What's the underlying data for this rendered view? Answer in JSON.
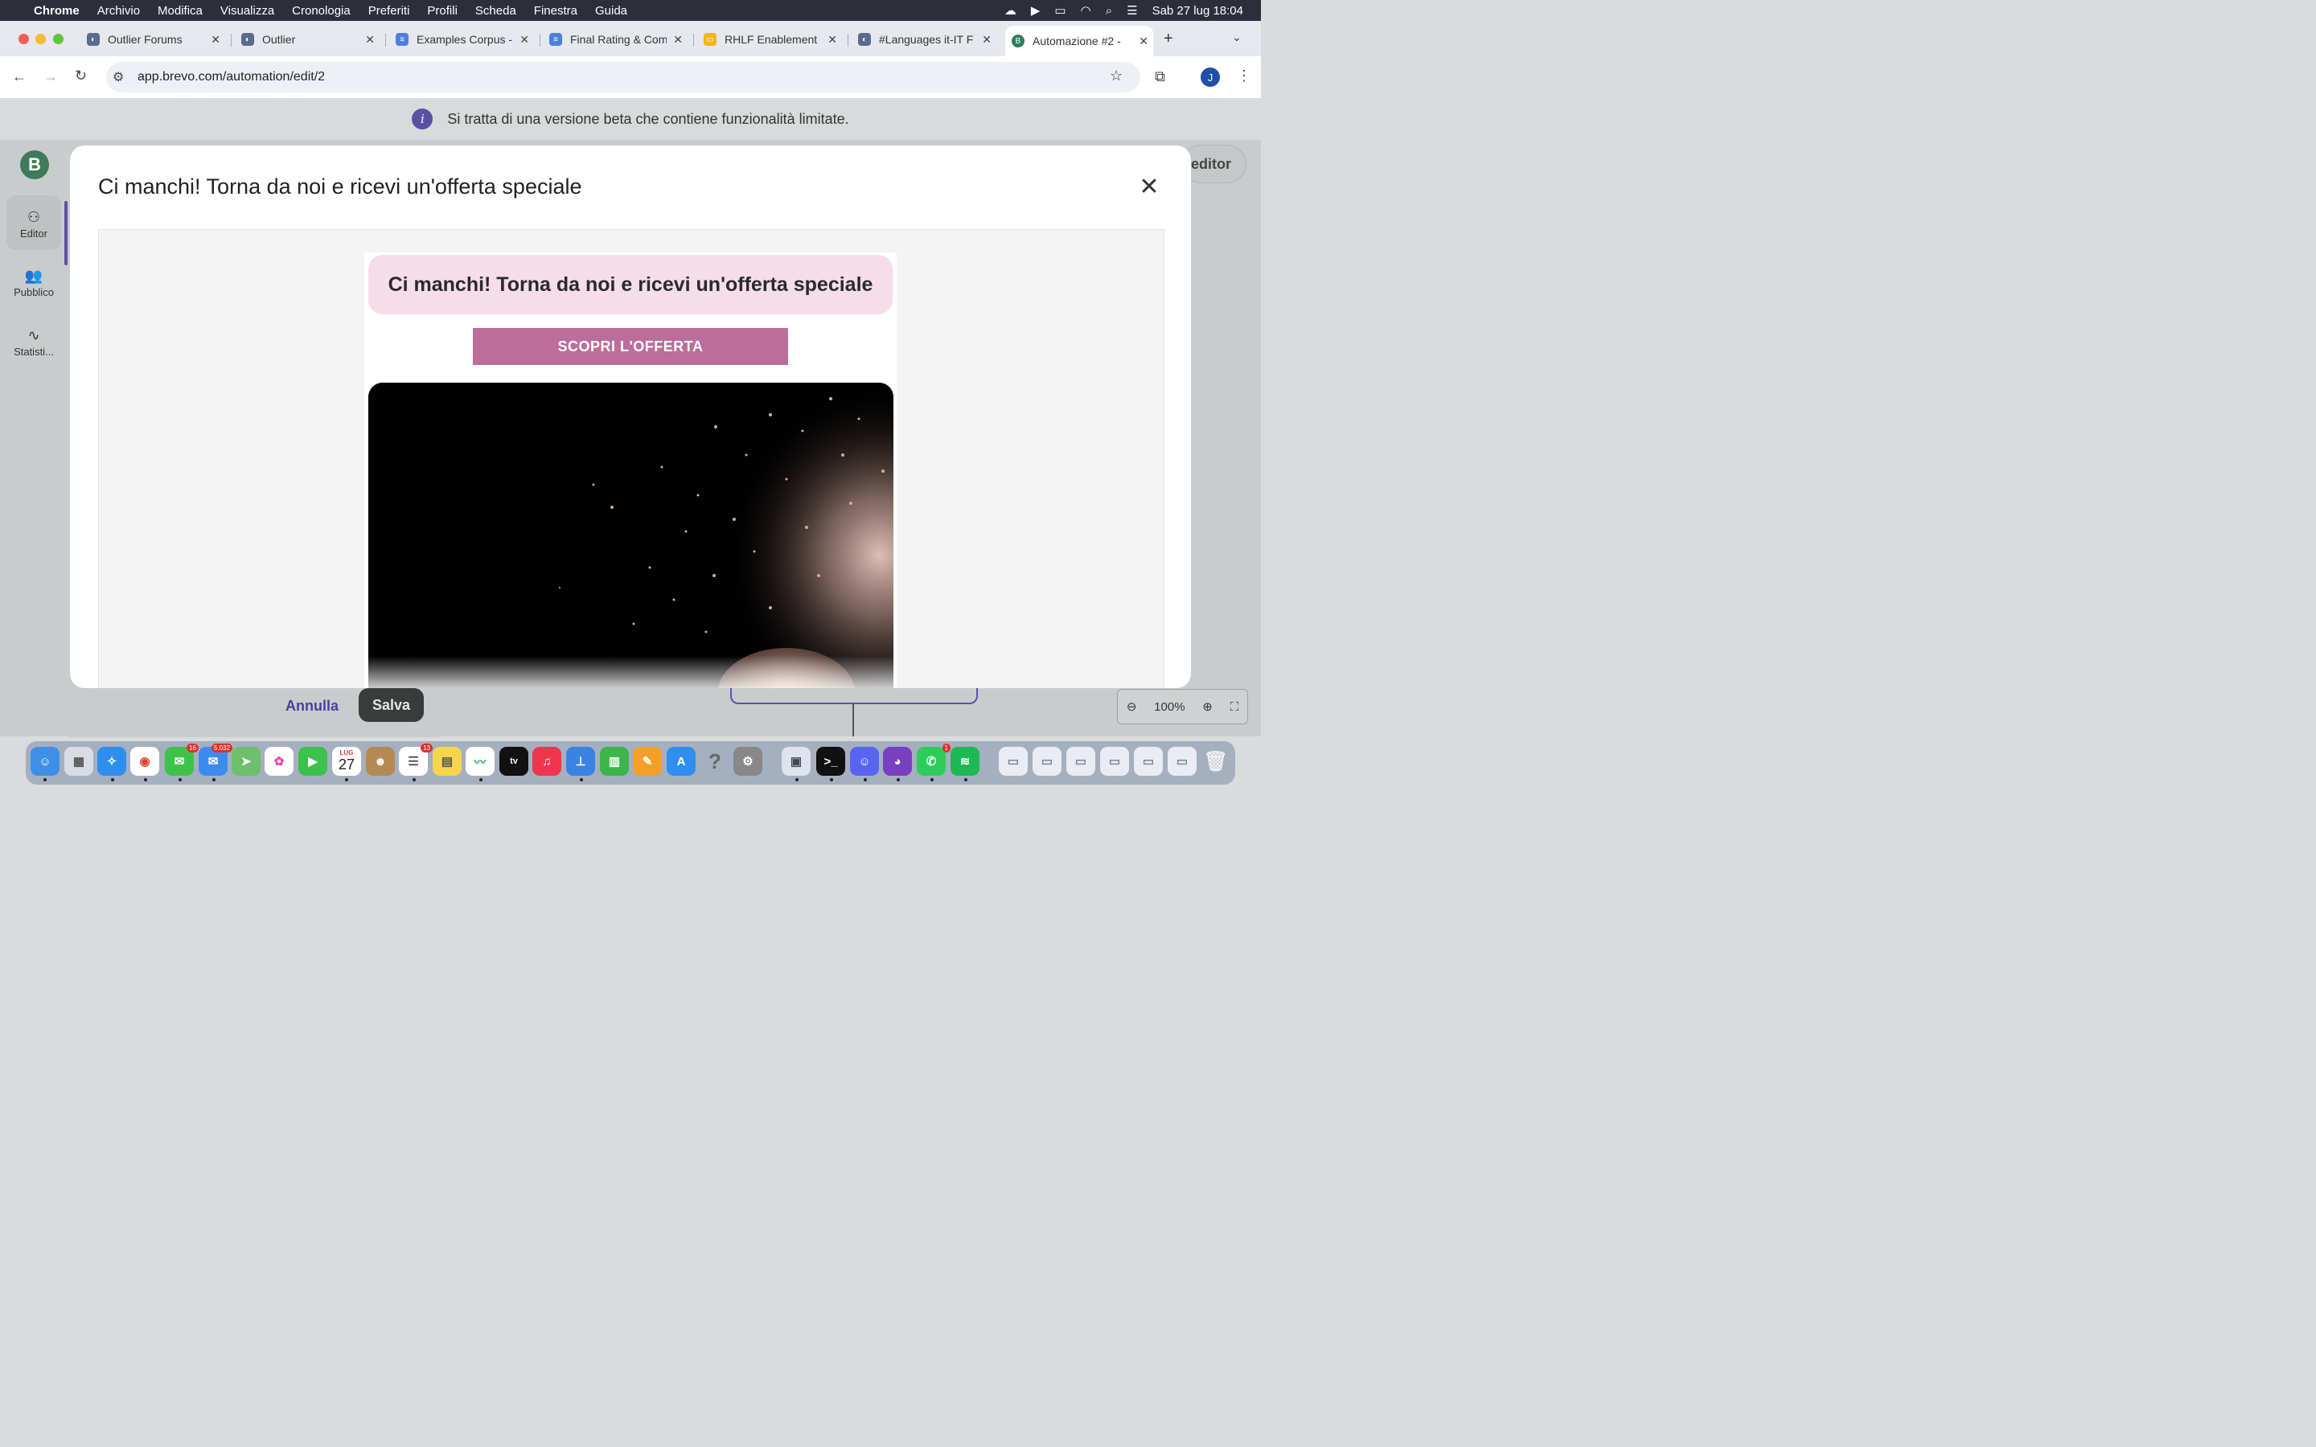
{
  "menubar": {
    "app_name": "Chrome",
    "menus": [
      "Archivio",
      "Modifica",
      "Visualizza",
      "Cronologia",
      "Preferiti",
      "Profili",
      "Scheda",
      "Finestra",
      "Guida"
    ],
    "datetime": "Sab 27 lug  18:04"
  },
  "tabs": [
    {
      "title": "Outlier Forums"
    },
    {
      "title": "Outlier"
    },
    {
      "title": "Examples Corpus -"
    },
    {
      "title": "Final Rating & Com"
    },
    {
      "title": "RHLF Enablement"
    },
    {
      "title": "#Languages it-IT F"
    },
    {
      "title": "Automazione #2 -"
    }
  ],
  "address_bar": {
    "url": "app.brevo.com/automation/edit/2"
  },
  "profile_initial": "J",
  "page": {
    "beta_banner": "Si tratta di una versione beta che contiene funzionalità limitate.",
    "logo_letter": "B",
    "editor_button": "editor",
    "sidebar": [
      {
        "label": "Editor"
      },
      {
        "label": "Pubblico"
      },
      {
        "label": "Statisti..."
      }
    ],
    "cancel_label": "Annulla",
    "save_label": "Salva",
    "zoom_level": "100%"
  },
  "modal": {
    "title": "Ci manchi! Torna da noi e ricevi un'offerta speciale",
    "email": {
      "headline": "Ci manchi! Torna da noi e ricevi un'offerta speciale",
      "cta": "SCOPRI L'OFFERTA"
    }
  },
  "dock": {
    "apps": [
      "Finder",
      "Launchpad",
      "Safari",
      "Chrome",
      "Messaggi",
      "Mail",
      "Mappe",
      "Foto",
      "FaceTime",
      "Calendario",
      "Contatti",
      "Promemoria",
      "Note",
      "Freeform",
      "TV",
      "Musica",
      "Keynote",
      "Numbers",
      "Pages",
      "App Store",
      "Aiuto",
      "Impostazioni",
      "Anteprima",
      "Terminale",
      "Discord",
      "GitHub Desktop",
      "WhatsApp",
      "Spotify",
      "Cestino"
    ],
    "badges": {
      "messages": "16",
      "mail": "5.032",
      "reminders": "13",
      "whatsapp": "1"
    },
    "calendar_month": "LUG",
    "calendar_day": "27"
  }
}
